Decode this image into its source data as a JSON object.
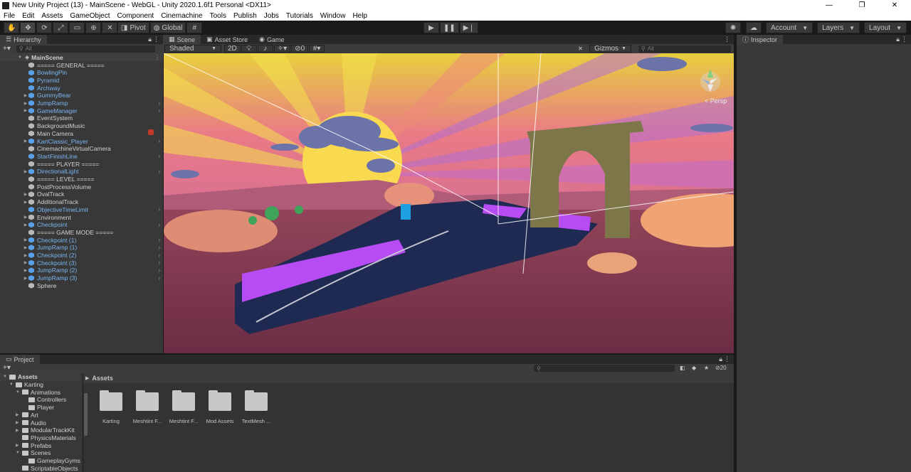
{
  "window": {
    "title": "New Unity Project (13) - MainScene - WebGL - Unity 2020.1.6f1 Personal <DX11>",
    "minimize": "—",
    "maximize": "❐",
    "close": "✕"
  },
  "menu": [
    "File",
    "Edit",
    "Assets",
    "GameObject",
    "Component",
    "Cinemachine",
    "Tools",
    "Publish",
    "Jobs",
    "Tutorials",
    "Window",
    "Help"
  ],
  "toolbar": {
    "pivot_label": "Pivot",
    "global_label": "Global",
    "account_label": "Account",
    "layers_label": "Layers",
    "layout_label": "Layout"
  },
  "hierarchy": {
    "tab": "Hierarchy",
    "search_placeholder": "All",
    "scene_name": "MainScene",
    "items": [
      {
        "label": "===== GENERAL =====",
        "prefab": false,
        "arrow": false,
        "chev": false
      },
      {
        "label": "BowlingPin",
        "prefab": true,
        "arrow": false,
        "chev": false
      },
      {
        "label": "Pyramid",
        "prefab": true,
        "arrow": false,
        "chev": false
      },
      {
        "label": "Archway",
        "prefab": true,
        "arrow": false,
        "chev": false
      },
      {
        "label": "GummyBear",
        "prefab": true,
        "arrow": true,
        "chev": false
      },
      {
        "label": "JumpRamp",
        "prefab": true,
        "arrow": true,
        "chev": true
      },
      {
        "label": "GameManager",
        "prefab": true,
        "arrow": true,
        "chev": true
      },
      {
        "label": "EventSystem",
        "prefab": false,
        "arrow": false,
        "chev": false
      },
      {
        "label": "BackgroundMusic",
        "prefab": false,
        "arrow": false,
        "chev": false
      },
      {
        "label": "Main Camera",
        "prefab": false,
        "arrow": false,
        "chev": false
      },
      {
        "label": "KartClassic_Player",
        "prefab": true,
        "arrow": true,
        "chev": true
      },
      {
        "label": "CinemachineVirtualCamera",
        "prefab": false,
        "arrow": false,
        "chev": false
      },
      {
        "label": "StartFinishLine",
        "prefab": true,
        "arrow": false,
        "chev": true
      },
      {
        "label": "===== PLAYER =====",
        "prefab": false,
        "arrow": false,
        "chev": false
      },
      {
        "label": "DirectionalLight",
        "prefab": true,
        "arrow": true,
        "chev": true
      },
      {
        "label": "===== LEVEL =====",
        "prefab": false,
        "arrow": false,
        "chev": false
      },
      {
        "label": "PostProcessVolume",
        "prefab": false,
        "arrow": false,
        "chev": false
      },
      {
        "label": "OvalTrack",
        "prefab": false,
        "arrow": true,
        "chev": false
      },
      {
        "label": "AdditionalTrack",
        "prefab": false,
        "arrow": true,
        "chev": false
      },
      {
        "label": "ObjectiveTimeLimit",
        "prefab": true,
        "arrow": false,
        "chev": true
      },
      {
        "label": "Environment",
        "prefab": false,
        "arrow": true,
        "chev": false
      },
      {
        "label": "Checkpoint",
        "prefab": true,
        "arrow": true,
        "chev": true
      },
      {
        "label": "===== GAME MODE =====",
        "prefab": false,
        "arrow": false,
        "chev": false
      },
      {
        "label": "Checkpoint (1)",
        "prefab": true,
        "arrow": true,
        "chev": true
      },
      {
        "label": "JumpRamp (1)",
        "prefab": true,
        "arrow": true,
        "chev": true
      },
      {
        "label": "Checkpoint (2)",
        "prefab": true,
        "arrow": true,
        "chev": true
      },
      {
        "label": "Checkpoint (3)",
        "prefab": true,
        "arrow": true,
        "chev": true
      },
      {
        "label": "JumpRamp (2)",
        "prefab": true,
        "arrow": true,
        "chev": true
      },
      {
        "label": "JumpRamp (3)",
        "prefab": true,
        "arrow": true,
        "chev": true
      },
      {
        "label": "Sphere",
        "prefab": false,
        "arrow": false,
        "chev": false
      }
    ]
  },
  "scene": {
    "tabs": [
      "Scene",
      "Asset Store",
      "Game"
    ],
    "shading_mode": "Shaded",
    "mode_2d": "2D",
    "fx_count": "0",
    "gizmos_label": "Gizmos",
    "search_placeholder": "All",
    "persp_label": "< Persp"
  },
  "inspector": {
    "tab": "Inspector"
  },
  "project": {
    "tab": "Project",
    "badge_count": "20",
    "breadcrumb": "Assets",
    "tree": [
      {
        "label": "Assets",
        "depth": 0,
        "arrow": "▼",
        "bold": true
      },
      {
        "label": "Karting",
        "depth": 1,
        "arrow": "▼",
        "bold": false
      },
      {
        "label": "Animations",
        "depth": 2,
        "arrow": "▼",
        "bold": false
      },
      {
        "label": "Controllers",
        "depth": 3,
        "arrow": "",
        "bold": false
      },
      {
        "label": "Player",
        "depth": 3,
        "arrow": "",
        "bold": false
      },
      {
        "label": "Art",
        "depth": 2,
        "arrow": "▶",
        "bold": false
      },
      {
        "label": "Audio",
        "depth": 2,
        "arrow": "▶",
        "bold": false
      },
      {
        "label": "ModularTrackKit",
        "depth": 2,
        "arrow": "▶",
        "bold": false
      },
      {
        "label": "PhysicsMaterials",
        "depth": 2,
        "arrow": "",
        "bold": false
      },
      {
        "label": "Prefabs",
        "depth": 2,
        "arrow": "▶",
        "bold": false
      },
      {
        "label": "Scenes",
        "depth": 2,
        "arrow": "▼",
        "bold": false
      },
      {
        "label": "GameplayGyms",
        "depth": 3,
        "arrow": "",
        "bold": false
      },
      {
        "label": "ScriptableObjects",
        "depth": 2,
        "arrow": "",
        "bold": false
      }
    ],
    "folders": [
      "Karting",
      "Meshtint F...",
      "Meshtint F...",
      "Mod Assets",
      "TextMesh ..."
    ]
  },
  "colors": {
    "prefab_text": "#7bb5f2",
    "panel_bg": "#383838",
    "sky_pink": "#e25f8f",
    "sun": "#f7d85a",
    "track": "#202a50",
    "magenta": "#b84cff"
  }
}
